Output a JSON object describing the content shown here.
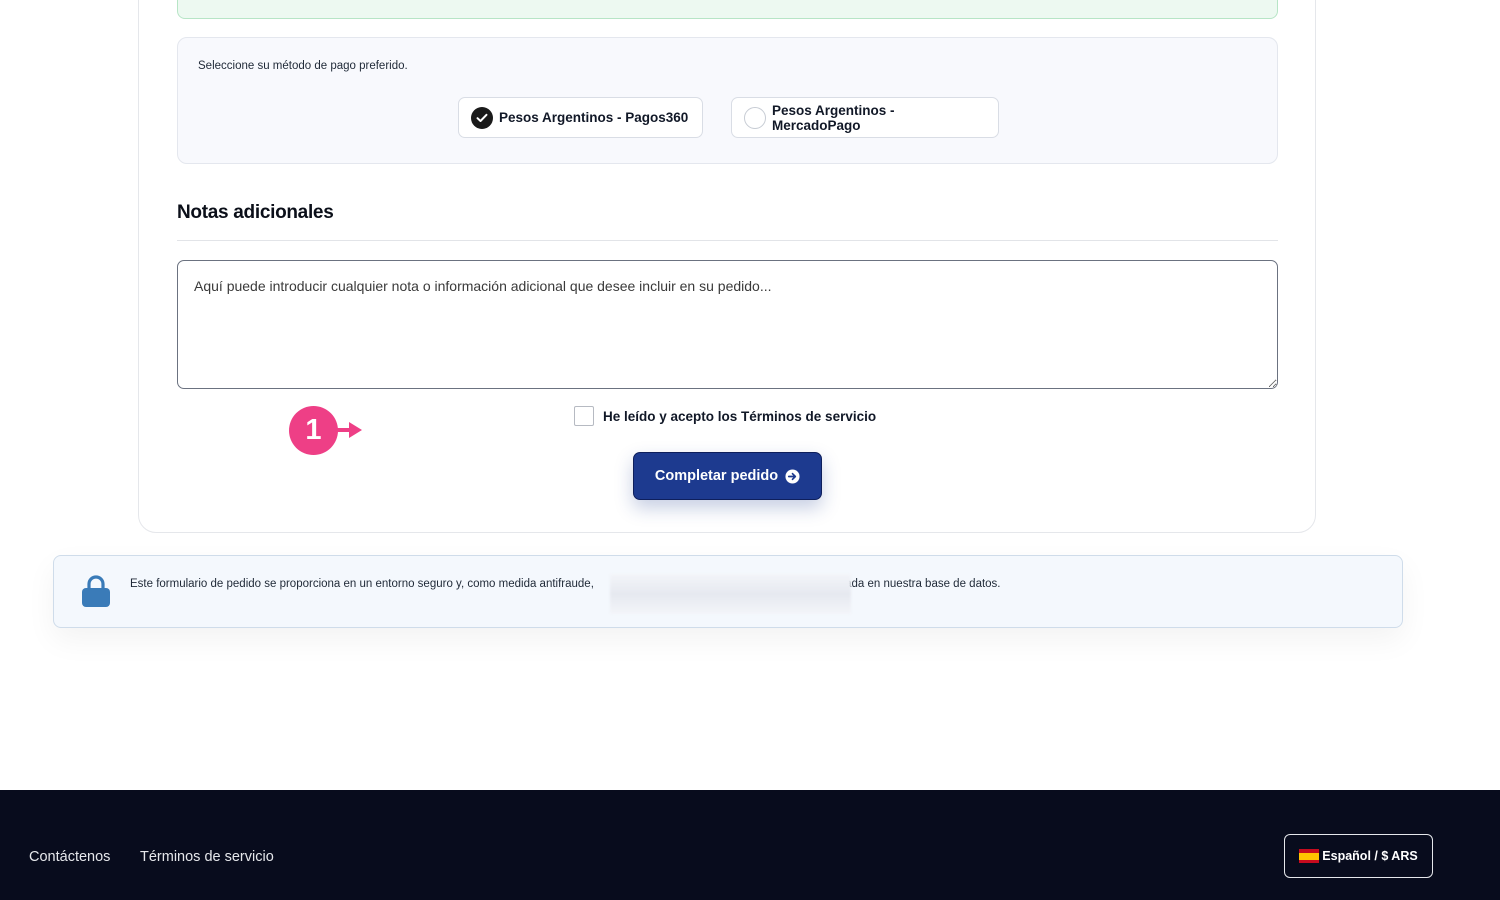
{
  "payment": {
    "instruction": "Seleccione su método de pago preferido.",
    "options": [
      {
        "label": "Pesos Argentinos - Pagos360",
        "selected": true
      },
      {
        "label": "Pesos Argentinos - MercadoPago",
        "selected": false
      }
    ]
  },
  "notes": {
    "title": "Notas adicionales",
    "placeholder": "Aquí puede introducir cualquier nota o información adicional que desee incluir en su pedido..."
  },
  "terms": {
    "label": "He leído y acepto los Términos de servicio"
  },
  "submit": {
    "label": "Completar pedido"
  },
  "annotation": {
    "number": "1",
    "color": "#ee3f86"
  },
  "security": {
    "text_before": "Este formulario de pedido se proporciona en un entorno seguro y, como medida antifraude,",
    "text_after": "rdada en nuestra base de datos."
  },
  "footer": {
    "links": [
      "Contáctenos",
      "Términos de servicio"
    ],
    "language_currency": "Español / $ ARS"
  },
  "colors": {
    "primary_button": "#1d3a8f",
    "footer_bg": "#080c1d",
    "lock_icon": "#3a7bb8"
  }
}
